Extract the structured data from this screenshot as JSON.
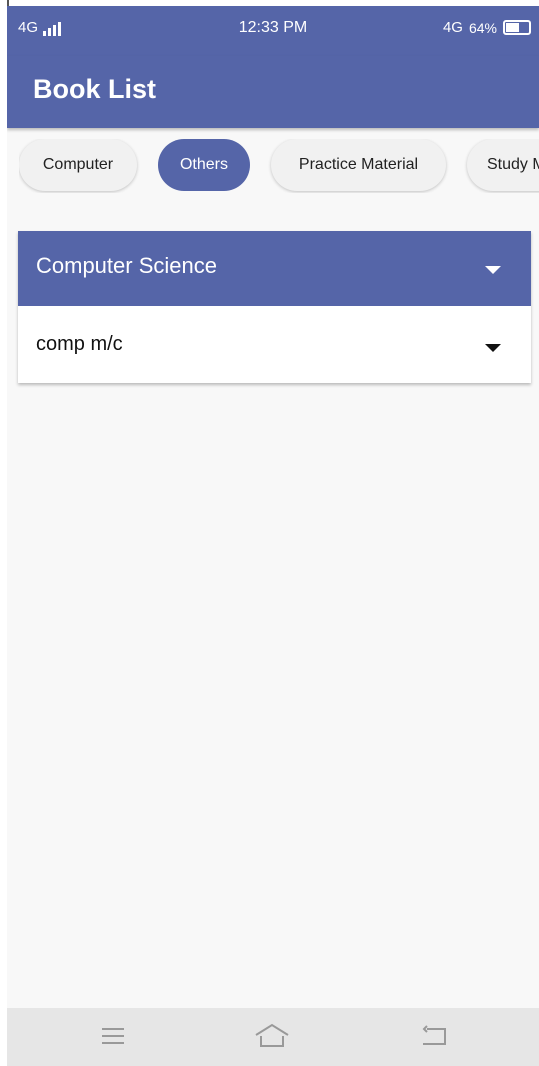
{
  "status_bar": {
    "network_left": "4G",
    "time": "12:33 PM",
    "network_right": "4G",
    "battery_percent": "64%",
    "battery_level": 0.64
  },
  "app_bar": {
    "title": "Book List"
  },
  "chips": [
    {
      "label": "Computer",
      "active": false
    },
    {
      "label": "Others",
      "active": true
    },
    {
      "label": "Practice Material",
      "active": false
    },
    {
      "label": "Study Material",
      "active": false
    }
  ],
  "dropdown": {
    "header_label": "Computer Science",
    "row_label": "comp m/c"
  },
  "nav": {
    "icons": [
      "menu-icon",
      "home-icon",
      "back-icon"
    ]
  },
  "colors": {
    "primary": "#5565a8",
    "background": "#f8f8f8",
    "nav_bar": "#e6e6e6"
  }
}
